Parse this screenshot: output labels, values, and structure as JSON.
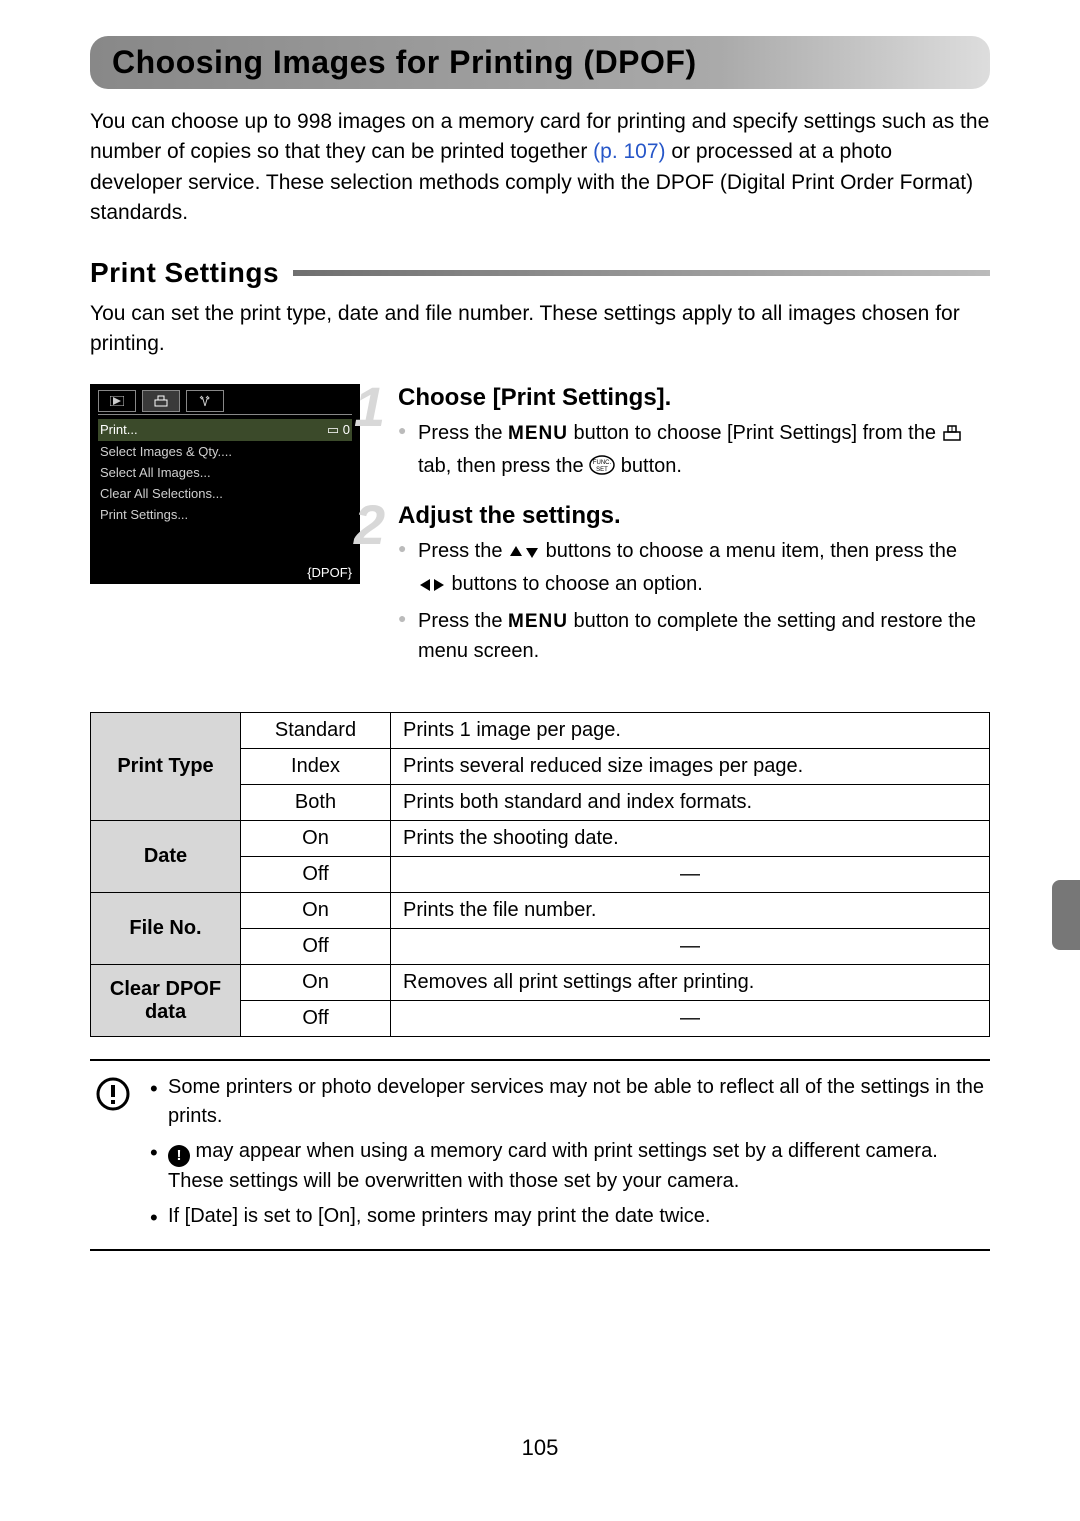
{
  "title": "Choosing Images for Printing (DPOF)",
  "intro_a": "You can choose up to 998 images on a memory card for printing and specify settings such as the number of copies so that they can be printed together ",
  "intro_pageref": "(p. 107)",
  "intro_b": " or processed at a photo developer service. These selection methods comply with the DPOF (Digital Print Order Format) standards.",
  "section_title": "Print Settings",
  "section_intro": "You can set the print type, date and file number. These settings apply to all images chosen for printing.",
  "lcd": {
    "rows": [
      {
        "label": "Print...",
        "value": "▭ 0",
        "selected": true
      },
      {
        "label": "Select Images & Qty....",
        "value": ""
      },
      {
        "label": "Select All Images...",
        "value": ""
      },
      {
        "label": "Clear All Selections...",
        "value": ""
      },
      {
        "label": "Print Settings...",
        "value": ""
      }
    ],
    "dpof": "{DPOF}"
  },
  "steps": [
    {
      "num": "1",
      "heading": "Choose [Print Settings].",
      "bullets": [
        {
          "parts": [
            "Press the ",
            "{MENU}",
            " button to choose [Print Settings] from the ",
            "{PRINT_TAB}",
            " tab, then press the ",
            "{FUNCSET}",
            " button."
          ]
        }
      ]
    },
    {
      "num": "2",
      "heading": "Adjust the settings.",
      "bullets": [
        {
          "parts": [
            "Press the ",
            "{UPDOWN}",
            " buttons to choose a menu item, then press the ",
            "{LEFTRIGHT}",
            " buttons to choose an option."
          ]
        },
        {
          "parts": [
            "Press the ",
            "{MENU}",
            " button to complete the setting and restore the menu screen."
          ]
        }
      ]
    }
  ],
  "table": [
    {
      "head": "Print Type",
      "span": 3,
      "opt": "Standard",
      "desc": "Prints 1 image per page."
    },
    {
      "opt": "Index",
      "desc": "Prints several reduced size images per page."
    },
    {
      "opt": "Both",
      "desc": "Prints both standard and index formats."
    },
    {
      "head": "Date",
      "span": 2,
      "opt": "On",
      "desc": "Prints the shooting date."
    },
    {
      "opt": "Off",
      "desc": "—",
      "dash": true
    },
    {
      "head": "File No.",
      "span": 2,
      "opt": "On",
      "desc": "Prints the file number."
    },
    {
      "opt": "Off",
      "desc": "—",
      "dash": true
    },
    {
      "head": "Clear DPOF data",
      "span": 2,
      "opt": "On",
      "desc": "Removes all print settings after printing."
    },
    {
      "opt": "Off",
      "desc": "—",
      "dash": true
    }
  ],
  "caution": [
    "Some printers or photo developer services may not be able to reflect all of the settings in the prints.",
    "{INFO} may appear when using a memory card with print settings set by a different camera. These settings will be overwritten with those set by your camera.",
    "If [Date] is set to [On], some printers may print the date twice."
  ],
  "page_number": "105"
}
